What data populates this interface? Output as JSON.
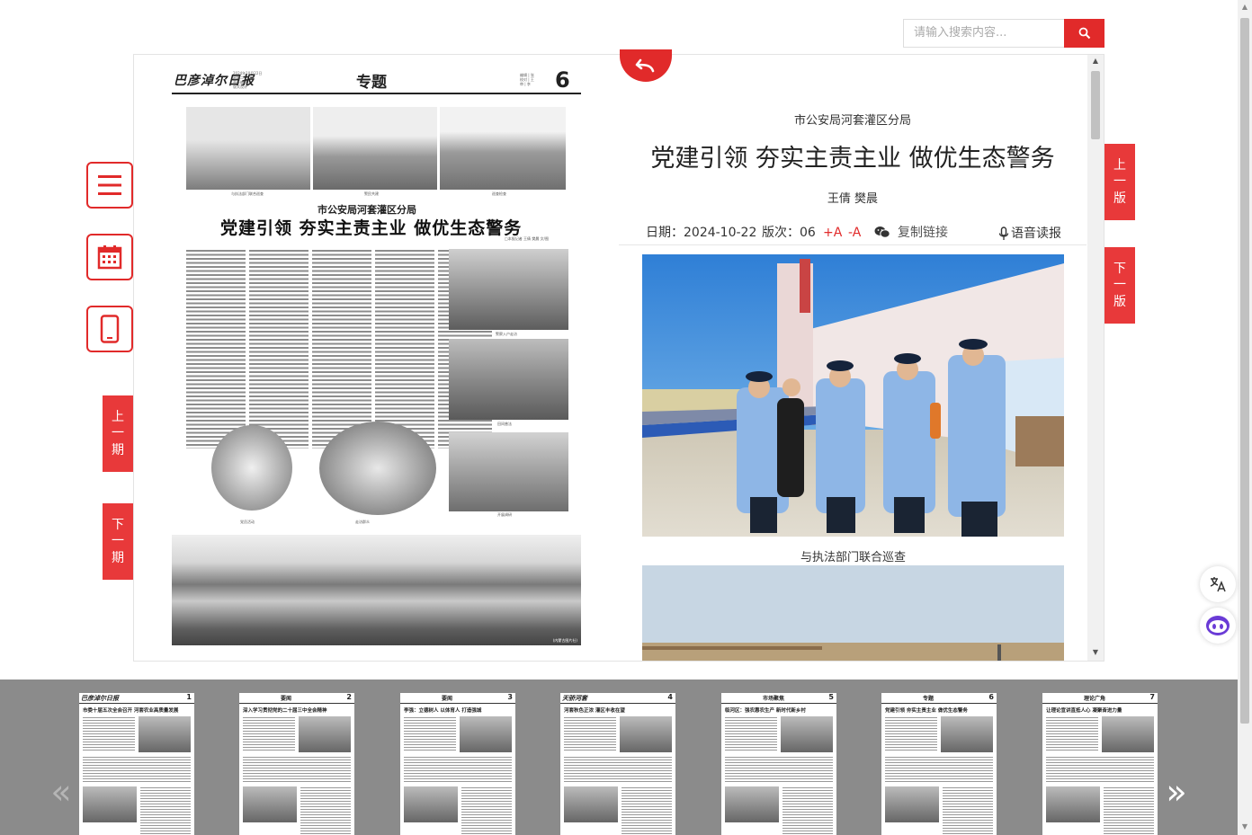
{
  "search": {
    "placeholder": "请输入搜索内容..."
  },
  "side_nav": {
    "prev_page": [
      "上",
      "一",
      "版"
    ],
    "next_page": [
      "下",
      "一",
      "版"
    ],
    "prev_issue": [
      "上",
      "一",
      "期"
    ],
    "next_issue": [
      "下",
      "一",
      "期"
    ]
  },
  "newspaper": {
    "masthead": "巴彦淖尔日报",
    "masthead_info": [
      "2024年10月22日",
      "星期二",
      "责任编辑",
      "版式设计"
    ],
    "section": "专题",
    "editors_info": [
      "编辑 | 张",
      "校对 | 王",
      "审 | 李"
    ],
    "page_number": "6",
    "title_top": "市公安局河套灌区分局",
    "title_main": "党建引领 夯实主责主业 做优生态警务",
    "byline": "□本报记者 王倩 樊晨 文/图",
    "captions": [
      "与执法部门联合巡查",
      "警民共建",
      "巡查检查",
      "警察入户走访",
      "田间普法",
      "党员活动",
      "走访群众",
      "开展调研"
    ],
    "footer": "(内蒙古图片社)"
  },
  "article": {
    "subtitle": "市公安局河套灌区分局",
    "title": "党建引领 夯实主责主业 做优生态警务",
    "author": "王倩 樊晨",
    "date_label": "日期：",
    "date": "2024-10-22",
    "edition_label": "版次：",
    "edition": "06",
    "font_plus": "+A",
    "font_minus": "-A",
    "copy_link": "复制链接",
    "read_aloud": "语音读报",
    "image1_caption": "与执法部门联合巡查"
  },
  "thumbnails": [
    {
      "page": "1",
      "logo": "巴彦淖尔日报",
      "section": "",
      "headline": "市委十届五次全会召开 河套农业高质量发展"
    },
    {
      "page": "2",
      "logo": "",
      "section": "要闻",
      "headline": "深入学习贯彻党的二十届三中全会精神"
    },
    {
      "page": "3",
      "logo": "",
      "section": "要闻",
      "headline": "李强：立德树人 以体育人 打造强城"
    },
    {
      "page": "4",
      "logo": "天骄河套",
      "section": "",
      "headline": "河套秋色正浓 灌区丰收在望"
    },
    {
      "page": "5",
      "logo": "",
      "section": "市场聚焦",
      "headline": "临河区：强农惠农生产 新时代新乡村"
    },
    {
      "page": "6",
      "logo": "",
      "section": "专题",
      "headline": "党建引领 夯实主责主业 做优生态警务"
    },
    {
      "page": "7",
      "logo": "",
      "section": "理论广角",
      "headline": "让理论宣讲直抵人心 凝聚奋进力量"
    }
  ],
  "colors": {
    "accent": "#e12a2a",
    "tab": "#e8393a",
    "strip": "#8b8b8b"
  },
  "icons": [
    "search-icon",
    "menu-icon",
    "calendar-icon",
    "mobile-icon",
    "return-icon",
    "wechat-icon",
    "speaker-icon",
    "translate-icon",
    "robot-icon"
  ]
}
